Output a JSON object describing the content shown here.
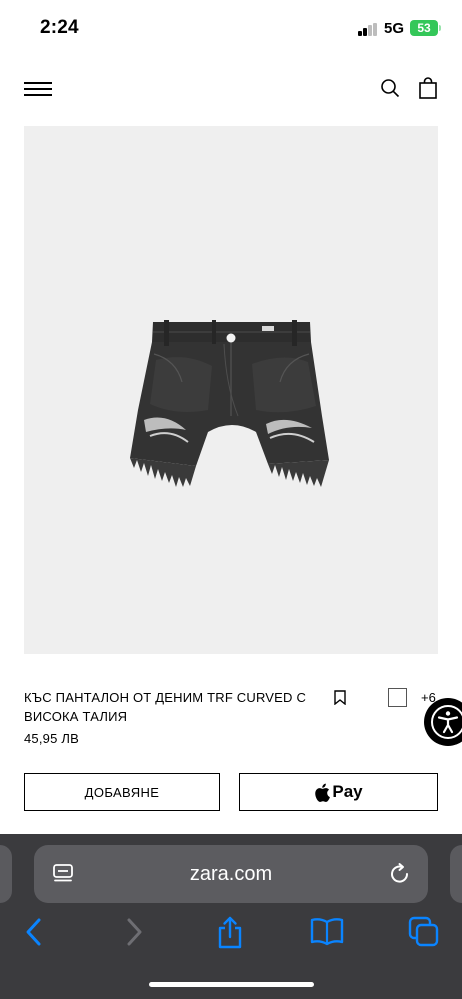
{
  "status_bar": {
    "time": "2:24",
    "network": "5G",
    "battery": "53"
  },
  "header": {
    "menu_icon": "hamburger-menu-icon",
    "search_icon": "search-icon",
    "bag_icon": "shopping-bag-icon"
  },
  "product": {
    "name": "КЪС ПАНТАЛОН ОТ ДЕНИМ TRF CURVED С ВИСОКА ТАЛИЯ",
    "price": "45,95 ЛВ",
    "more_colors": "+6",
    "swatch_color": "#ffffff"
  },
  "actions": {
    "add_label": "ДОБАВЯНЕ",
    "apple_pay_label": "Pay"
  },
  "browser": {
    "url": "zara.com"
  },
  "colors": {
    "accent_battery": "#34c759",
    "safari_blue": "#0a84ff",
    "image_background": "#efefef"
  }
}
